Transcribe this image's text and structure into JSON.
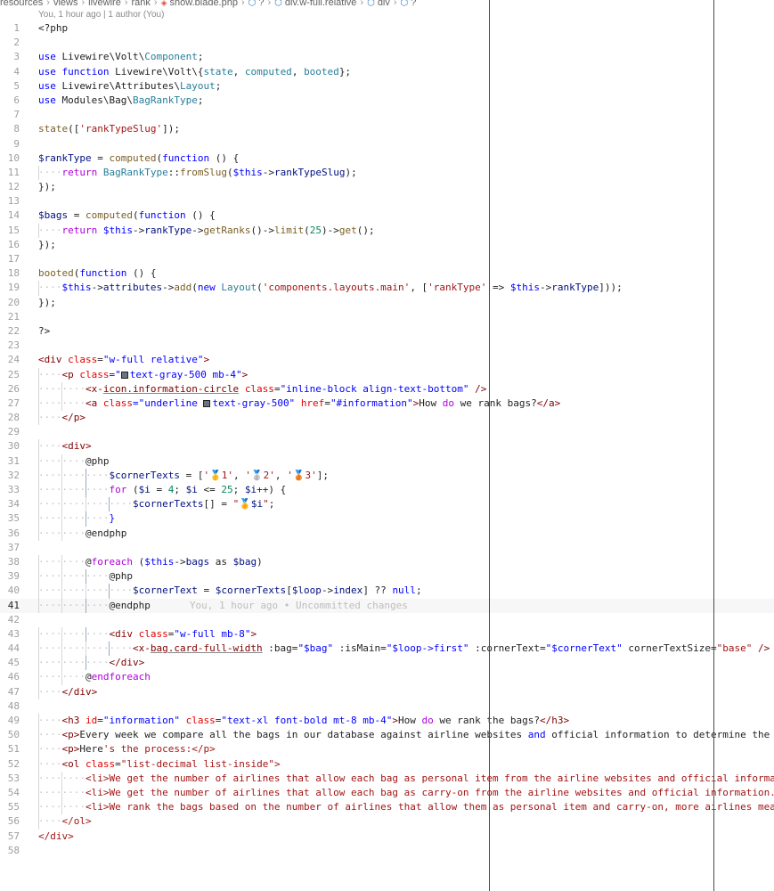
{
  "breadcrumb": [
    "resources",
    "views",
    "livewire",
    "rank",
    "show.blade.php",
    "?",
    "div.w-full.relative",
    "div",
    "?"
  ],
  "blame_top": "You, 1 hour ago | 1 author (You)",
  "current_line": 41,
  "colors": {
    "keyword": "#0000ff",
    "control": "#af00db",
    "variable": "#001080",
    "type": "#267f99",
    "function": "#795e26",
    "string": "#a31515",
    "number": "#098658",
    "tag": "#800000",
    "attr": "#e50000",
    "plain": "#1f1f1f",
    "swatch_gray": "#6b7280"
  },
  "lines": [
    {
      "n": 1,
      "indent": 0,
      "tokens": [
        [
          "<?php",
          "plain"
        ]
      ]
    },
    {
      "n": 2,
      "indent": 0,
      "tokens": []
    },
    {
      "n": 3,
      "indent": 0,
      "tokens": [
        [
          "use",
          "keyword"
        ],
        [
          " Livewire\\Volt\\",
          "plain"
        ],
        [
          "Component",
          "type"
        ],
        [
          ";",
          "plain"
        ]
      ]
    },
    {
      "n": 4,
      "indent": 0,
      "tokens": [
        [
          "use",
          "keyword"
        ],
        [
          " ",
          "plain"
        ],
        [
          "function",
          "keyword"
        ],
        [
          " Livewire\\Volt\\{",
          "plain"
        ],
        [
          "state",
          "type"
        ],
        [
          ", ",
          "plain"
        ],
        [
          "computed",
          "type"
        ],
        [
          ", ",
          "plain"
        ],
        [
          "booted",
          "type"
        ],
        [
          "};",
          "plain"
        ]
      ]
    },
    {
      "n": 5,
      "indent": 0,
      "tokens": [
        [
          "use",
          "keyword"
        ],
        [
          " Livewire\\Attributes\\",
          "plain"
        ],
        [
          "Layout",
          "type"
        ],
        [
          ";",
          "plain"
        ]
      ]
    },
    {
      "n": 6,
      "indent": 0,
      "tokens": [
        [
          "use",
          "keyword"
        ],
        [
          " Modules\\Bag\\",
          "plain"
        ],
        [
          "BagRankType",
          "type"
        ],
        [
          ";",
          "plain"
        ]
      ]
    },
    {
      "n": 7,
      "indent": 0,
      "tokens": []
    },
    {
      "n": 8,
      "indent": 0,
      "tokens": [
        [
          "state",
          "function"
        ],
        [
          "([",
          "plain"
        ],
        [
          "'rankTypeSlug'",
          "string"
        ],
        [
          "]);",
          "plain"
        ]
      ]
    },
    {
      "n": 9,
      "indent": 0,
      "tokens": []
    },
    {
      "n": 10,
      "indent": 0,
      "tokens": [
        [
          "$rankType",
          "variable"
        ],
        [
          " = ",
          "plain"
        ],
        [
          "computed",
          "function"
        ],
        [
          "(",
          "plain"
        ],
        [
          "function",
          "keyword"
        ],
        [
          " () {",
          "plain"
        ]
      ]
    },
    {
      "n": 11,
      "indent": 1,
      "tokens": [
        [
          "return",
          "control"
        ],
        [
          " ",
          "plain"
        ],
        [
          "BagRankType",
          "type"
        ],
        [
          "::",
          "plain"
        ],
        [
          "fromSlug",
          "function"
        ],
        [
          "(",
          "plain"
        ],
        [
          "$this",
          "keyword"
        ],
        [
          "->",
          "plain"
        ],
        [
          "rankTypeSlug",
          "variable"
        ],
        [
          ");",
          "plain"
        ]
      ]
    },
    {
      "n": 12,
      "indent": 0,
      "tokens": [
        [
          "});",
          "plain"
        ]
      ]
    },
    {
      "n": 13,
      "indent": 0,
      "tokens": []
    },
    {
      "n": 14,
      "indent": 0,
      "tokens": [
        [
          "$bags",
          "variable"
        ],
        [
          " = ",
          "plain"
        ],
        [
          "computed",
          "function"
        ],
        [
          "(",
          "plain"
        ],
        [
          "function",
          "keyword"
        ],
        [
          " () {",
          "plain"
        ]
      ]
    },
    {
      "n": 15,
      "indent": 1,
      "tokens": [
        [
          "return",
          "control"
        ],
        [
          " ",
          "plain"
        ],
        [
          "$this",
          "keyword"
        ],
        [
          "->",
          "plain"
        ],
        [
          "rankType",
          "variable"
        ],
        [
          "->",
          "plain"
        ],
        [
          "getRanks",
          "function"
        ],
        [
          "()->",
          "plain"
        ],
        [
          "limit",
          "function"
        ],
        [
          "(",
          "plain"
        ],
        [
          "25",
          "number"
        ],
        [
          ")->",
          "plain"
        ],
        [
          "get",
          "function"
        ],
        [
          "();",
          "plain"
        ]
      ]
    },
    {
      "n": 16,
      "indent": 0,
      "tokens": [
        [
          "});",
          "plain"
        ]
      ]
    },
    {
      "n": 17,
      "indent": 0,
      "tokens": []
    },
    {
      "n": 18,
      "indent": 0,
      "tokens": [
        [
          "booted",
          "function"
        ],
        [
          "(",
          "plain"
        ],
        [
          "function",
          "keyword"
        ],
        [
          " () {",
          "plain"
        ]
      ]
    },
    {
      "n": 19,
      "indent": 1,
      "tokens": [
        [
          "$this",
          "keyword"
        ],
        [
          "->",
          "plain"
        ],
        [
          "attributes",
          "variable"
        ],
        [
          "->",
          "plain"
        ],
        [
          "add",
          "function"
        ],
        [
          "(",
          "plain"
        ],
        [
          "new",
          "keyword"
        ],
        [
          " ",
          "plain"
        ],
        [
          "Layout",
          "type"
        ],
        [
          "(",
          "plain"
        ],
        [
          "'components.layouts.main'",
          "string"
        ],
        [
          ", [",
          "plain"
        ],
        [
          "'rankType'",
          "string"
        ],
        [
          " => ",
          "plain"
        ],
        [
          "$this",
          "keyword"
        ],
        [
          "->",
          "plain"
        ],
        [
          "rankType",
          "variable"
        ],
        [
          "]));",
          "plain"
        ]
      ]
    },
    {
      "n": 20,
      "indent": 0,
      "tokens": [
        [
          "});",
          "plain"
        ]
      ]
    },
    {
      "n": 21,
      "indent": 0,
      "tokens": []
    },
    {
      "n": 22,
      "indent": 0,
      "tokens": [
        [
          "?>",
          "plain"
        ]
      ]
    },
    {
      "n": 23,
      "indent": 0,
      "tokens": []
    },
    {
      "n": 24,
      "indent": 0,
      "tokens": [
        [
          "<div",
          "tag"
        ],
        [
          " ",
          "plain"
        ],
        [
          "class",
          "attr"
        ],
        [
          "=",
          "plain"
        ],
        [
          "\"w-full relative\"",
          "keyword"
        ],
        [
          ">",
          "tag"
        ]
      ]
    },
    {
      "n": 25,
      "indent": 1,
      "tokens": [
        [
          "<p",
          "tag"
        ],
        [
          " ",
          "plain"
        ],
        [
          "class",
          "attr"
        ],
        [
          "=\"",
          "keyword"
        ],
        [
          "SWATCH",
          "swatch"
        ],
        [
          "text-gray-500 mb-4\"",
          "keyword"
        ],
        [
          ">",
          "tag"
        ]
      ]
    },
    {
      "n": 26,
      "indent": 2,
      "tokens": [
        [
          "<x-",
          "tag"
        ],
        [
          "icon.information-circle",
          "tag_und"
        ],
        [
          " ",
          "plain"
        ],
        [
          "class",
          "attr"
        ],
        [
          "=",
          "plain"
        ],
        [
          "\"inline-block align-text-bottom\"",
          "keyword"
        ],
        [
          " />",
          "tag"
        ]
      ]
    },
    {
      "n": 27,
      "indent": 2,
      "tokens": [
        [
          "<a",
          "tag"
        ],
        [
          " ",
          "plain"
        ],
        [
          "class",
          "attr"
        ],
        [
          "=\"underline ",
          "keyword"
        ],
        [
          "SWATCH",
          "swatch"
        ],
        [
          "text-gray-500\"",
          "keyword"
        ],
        [
          " ",
          "plain"
        ],
        [
          "href",
          "attr"
        ],
        [
          "=",
          "plain"
        ],
        [
          "\"#information\"",
          "keyword"
        ],
        [
          ">",
          "tag"
        ],
        [
          "How ",
          "plain"
        ],
        [
          "do",
          "control"
        ],
        [
          " we rank bags?",
          "plain"
        ],
        [
          "</a>",
          "tag"
        ]
      ]
    },
    {
      "n": 28,
      "indent": 1,
      "tokens": [
        [
          "</p>",
          "tag"
        ]
      ]
    },
    {
      "n": 29,
      "indent": 0,
      "tokens": []
    },
    {
      "n": 30,
      "indent": 1,
      "tokens": [
        [
          "<div>",
          "tag"
        ]
      ]
    },
    {
      "n": 31,
      "indent": 2,
      "tokens": [
        [
          "@php",
          "plain"
        ]
      ]
    },
    {
      "n": 32,
      "indent": 3,
      "tokens": [
        [
          "$cornerTexts",
          "variable"
        ],
        [
          " = [",
          "plain"
        ],
        [
          "'🥇1'",
          "string"
        ],
        [
          ", ",
          "plain"
        ],
        [
          "'🥈2'",
          "string"
        ],
        [
          ", ",
          "plain"
        ],
        [
          "'🥉3'",
          "string"
        ],
        [
          "];",
          "plain"
        ]
      ]
    },
    {
      "n": 33,
      "indent": 3,
      "tokens": [
        [
          "for",
          "control"
        ],
        [
          " (",
          "plain"
        ],
        [
          "$i",
          "variable"
        ],
        [
          " = ",
          "plain"
        ],
        [
          "4",
          "number"
        ],
        [
          "; ",
          "plain"
        ],
        [
          "$i",
          "variable"
        ],
        [
          " <= ",
          "plain"
        ],
        [
          "25",
          "number"
        ],
        [
          "; ",
          "plain"
        ],
        [
          "$i",
          "variable"
        ],
        [
          "++) {",
          "plain"
        ]
      ]
    },
    {
      "n": 34,
      "indent": 4,
      "tokens": [
        [
          "$cornerTexts",
          "variable"
        ],
        [
          "[] = ",
          "plain"
        ],
        [
          "\"🏅",
          "string"
        ],
        [
          "$i",
          "variable"
        ],
        [
          "\"",
          "string"
        ],
        [
          ";",
          "plain"
        ]
      ]
    },
    {
      "n": 35,
      "indent": 3,
      "tokens": [
        [
          "}",
          "keyword"
        ]
      ]
    },
    {
      "n": 36,
      "indent": 2,
      "tokens": [
        [
          "@endphp",
          "plain"
        ]
      ]
    },
    {
      "n": 37,
      "indent": 0,
      "tokens": []
    },
    {
      "n": 38,
      "indent": 2,
      "tokens": [
        [
          "@",
          "plain"
        ],
        [
          "foreach",
          "control"
        ],
        [
          " (",
          "plain"
        ],
        [
          "$this",
          "keyword"
        ],
        [
          "->",
          "plain"
        ],
        [
          "bags",
          "variable"
        ],
        [
          " as ",
          "plain"
        ],
        [
          "$bag",
          "variable"
        ],
        [
          ")",
          "plain"
        ]
      ]
    },
    {
      "n": 39,
      "indent": 3,
      "tokens": [
        [
          "@php",
          "plain"
        ]
      ]
    },
    {
      "n": 40,
      "indent": 4,
      "tokens": [
        [
          "$cornerText",
          "variable"
        ],
        [
          " = ",
          "plain"
        ],
        [
          "$cornerTexts",
          "variable"
        ],
        [
          "[",
          "plain"
        ],
        [
          "$loop",
          "variable"
        ],
        [
          "->",
          "plain"
        ],
        [
          "index",
          "variable"
        ],
        [
          "] ?? ",
          "plain"
        ],
        [
          "null",
          "keyword"
        ],
        [
          ";",
          "plain"
        ]
      ]
    },
    {
      "n": 41,
      "indent": 3,
      "tokens": [
        [
          "@endphp",
          "plain"
        ]
      ],
      "blame": "You, 1 hour ago • Uncommitted changes"
    },
    {
      "n": 42,
      "indent": 0,
      "tokens": []
    },
    {
      "n": 43,
      "indent": 3,
      "tokens": [
        [
          "<div",
          "tag"
        ],
        [
          " ",
          "plain"
        ],
        [
          "class",
          "attr"
        ],
        [
          "=",
          "plain"
        ],
        [
          "\"w-full mb-8\"",
          "keyword"
        ],
        [
          ">",
          "tag"
        ]
      ]
    },
    {
      "n": 44,
      "indent": 4,
      "tokens": [
        [
          "<x-",
          "tag"
        ],
        [
          "bag.card-full-width",
          "tag_und"
        ],
        [
          " :bag=",
          "plain"
        ],
        [
          "\"$bag\"",
          "keyword"
        ],
        [
          " :isMain=",
          "plain"
        ],
        [
          "\"$loop->first\"",
          "keyword"
        ],
        [
          " :cornerText=",
          "plain"
        ],
        [
          "\"$cornerText\"",
          "keyword"
        ],
        [
          " cornerTextSize=",
          "plain"
        ],
        [
          "\"base\"",
          "string"
        ],
        [
          " />",
          "tag"
        ]
      ]
    },
    {
      "n": 45,
      "indent": 3,
      "tokens": [
        [
          "</div>",
          "tag"
        ]
      ]
    },
    {
      "n": 46,
      "indent": 2,
      "tokens": [
        [
          "@",
          "plain"
        ],
        [
          "endforeach",
          "control"
        ]
      ]
    },
    {
      "n": 47,
      "indent": 1,
      "tokens": [
        [
          "</div>",
          "tag"
        ]
      ]
    },
    {
      "n": 48,
      "indent": 0,
      "tokens": []
    },
    {
      "n": 49,
      "indent": 1,
      "tokens": [
        [
          "<h3",
          "tag"
        ],
        [
          " ",
          "plain"
        ],
        [
          "id",
          "attr"
        ],
        [
          "=",
          "plain"
        ],
        [
          "\"information\"",
          "keyword"
        ],
        [
          " ",
          "plain"
        ],
        [
          "class",
          "attr"
        ],
        [
          "=",
          "plain"
        ],
        [
          "\"text-xl font-bold mt-8 mb-4\"",
          "keyword"
        ],
        [
          ">",
          "tag"
        ],
        [
          "How ",
          "plain"
        ],
        [
          "do",
          "control"
        ],
        [
          " we rank the bags?",
          "plain"
        ],
        [
          "</h3>",
          "tag"
        ]
      ]
    },
    {
      "n": 50,
      "indent": 1,
      "tokens": [
        [
          "<p>",
          "tag"
        ],
        [
          "Every week we compare all the bags in our database against airline websites ",
          "plain"
        ],
        [
          "and",
          "keyword"
        ],
        [
          " official information to determine the number",
          "plain"
        ]
      ]
    },
    {
      "n": 51,
      "indent": 1,
      "tokens": [
        [
          "<p>",
          "tag"
        ],
        [
          "Here",
          "plain"
        ],
        [
          "'s the process:</p>",
          "string"
        ]
      ]
    },
    {
      "n": 52,
      "indent": 1,
      "tokens": [
        [
          "<ol",
          "tag"
        ],
        [
          " ",
          "plain"
        ],
        [
          "class",
          "attr"
        ],
        [
          "=",
          "plain"
        ],
        [
          "\"list-decimal list-inside\"",
          "string"
        ],
        [
          ">",
          "string"
        ]
      ]
    },
    {
      "n": 53,
      "indent": 2,
      "tokens": [
        [
          "<li>We get the number of airlines that allow each bag as personal item from the airline websites and official information.<",
          "string"
        ]
      ]
    },
    {
      "n": 54,
      "indent": 2,
      "tokens": [
        [
          "<li>We get the number of airlines that allow each bag as carry-on from the airline websites and official information.</li>",
          "string"
        ]
      ]
    },
    {
      "n": 55,
      "indent": 2,
      "tokens": [
        [
          "<li>We rank the bags based on the number of airlines that allow them as personal item and carry-on, more airlines means a h",
          "string"
        ]
      ]
    },
    {
      "n": 56,
      "indent": 1,
      "tokens": [
        [
          "</ol>",
          "string"
        ]
      ]
    },
    {
      "n": 57,
      "indent": 0,
      "tokens": [
        [
          "</div>",
          "string"
        ]
      ]
    },
    {
      "n": 58,
      "indent": 0,
      "tokens": []
    }
  ]
}
